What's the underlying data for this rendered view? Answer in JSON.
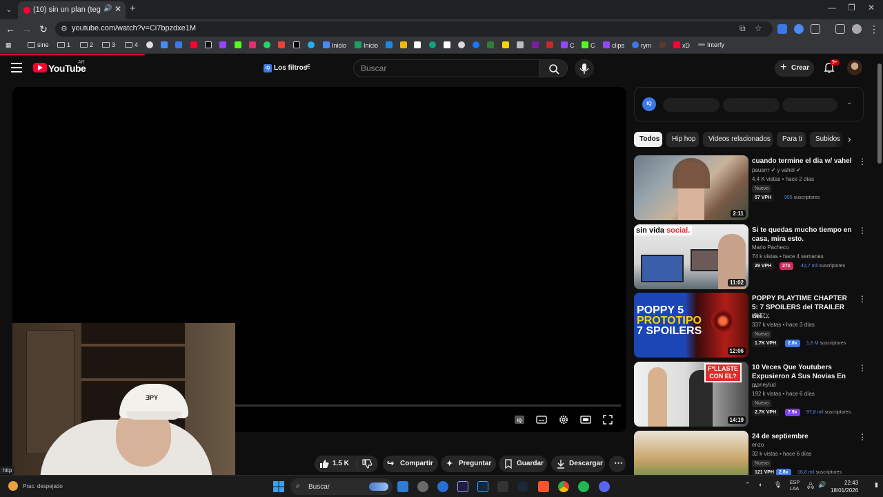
{
  "browser": {
    "tab_title": "(10) sin un plan (tegocalde...",
    "url": "youtube.com/watch?v=Ci7bpzdxe1M",
    "status_url": "http",
    "bookmarks": [
      {
        "label": "sine",
        "type": "folder"
      },
      {
        "label": "1",
        "type": "folder"
      },
      {
        "label": "2",
        "type": "folder"
      },
      {
        "label": "3",
        "type": "folder"
      },
      {
        "label": "4",
        "type": "folder"
      },
      {
        "label": "Inicio",
        "type": "link",
        "color": "#4a8af4"
      },
      {
        "label": "Inicio",
        "type": "link",
        "color": "#1aa260"
      },
      {
        "label": "C",
        "type": "link",
        "color": "#9146ff"
      },
      {
        "label": "C",
        "type": "link",
        "color": "#53fc18"
      },
      {
        "label": "clips",
        "type": "link",
        "color": "#9146ff"
      },
      {
        "label": "rym",
        "type": "link",
        "color": "#3b78e7"
      },
      {
        "label": "xD",
        "type": "link",
        "color": "#ff0033"
      },
      {
        "label": "Interfy",
        "type": "link",
        "color": "#888888"
      }
    ]
  },
  "youtube": {
    "logo_text": "YouTube",
    "country": "AR",
    "filters_label": "Los filtros",
    "search_placeholder": "Buscar",
    "create_label": "Crear",
    "notifications_badge": "9+"
  },
  "actions": {
    "likes": "1.5 K",
    "share": "Compartir",
    "ask": "Preguntar",
    "save": "Guardar",
    "download": "Descargar"
  },
  "webcam": {
    "cap_text": "ƎPY"
  },
  "iq_panel": {
    "logo": "IQ"
  },
  "chips": [
    "Todos",
    "Hip hop",
    "Videos relacionados",
    "Para ti",
    "Subidos"
  ],
  "recommendations": [
    {
      "title": "cuando termine el dia w/ vahel",
      "channel": "pausrrr ✔ y vahel ✔",
      "meta": "4.4 K vistas • hace 2 días",
      "badge": "Nuevo",
      "vph": "57 VPH",
      "multiplier": "",
      "subs_count": "955",
      "subs_label": "suscriptores",
      "duration": "2:11",
      "thumb_colors": [
        "#7d8a95",
        "#b8a58d"
      ]
    },
    {
      "title": "Si te quedas mucho tiempo en casa, mira esto.",
      "channel": "Mario Pacheco",
      "meta": "74 k vistas • hace 4 semanas",
      "badge": "",
      "vph": "29 VPH",
      "multiplier": "27x",
      "multiplier_color": "#e0245e",
      "subs_count": "40,7 mil",
      "subs_label": "suscriptores",
      "duration": "11:02",
      "thumb_text": "sin vida social.",
      "thumb_colors": [
        "#dcdcdc",
        "#5a6470"
      ]
    },
    {
      "title": "POPPY PLAYTIME CHAPTER 5: 7 SPOILERS del TRAILER del ...",
      "channel": "WIZZY",
      "meta": "337 k vistas • hace 3 días",
      "badge": "Nuevo",
      "vph": "1.7K VPH",
      "multiplier": "2.8x",
      "multiplier_color": "#3b78e7",
      "subs_count": "1,6 M",
      "subs_label": "suscriptores",
      "duration": "12:06",
      "thumb_text": "POPPY 5 PROTOTIPO 7 SPOILERS",
      "thumb_colors": [
        "#1b3fa8",
        "#c0201c"
      ]
    },
    {
      "title": "10 Veces Que Youtubers Expusieron A Sus Novias En ...",
      "channel": "moneylud",
      "meta": "192 k vistas • hace 6 días",
      "badge": "Nuevo",
      "vph": "2.7K VPH",
      "multiplier": "7.9x",
      "multiplier_color": "#7b3fe4",
      "subs_count": "97,8 mil",
      "subs_label": "suscriptores",
      "duration": "14:19",
      "thumb_text": "F*LLASTE CON EL?",
      "thumb_colors": [
        "#e8e8e8",
        "#3a3a3a"
      ]
    },
    {
      "title": "24 de septiembre",
      "channel": "enzo",
      "meta": "32 k vistas • hace 6 días",
      "badge": "Nuevo",
      "vph": "121 VPH",
      "multiplier": "2.8x",
      "multiplier_color": "#3b78e7",
      "subs_count": "16,8 mil",
      "subs_label": "suscriptores",
      "duration": "",
      "thumb_colors": [
        "#c8a060",
        "#7a8f4a"
      ]
    }
  ],
  "taskbar": {
    "weather": "Prac. despejado",
    "search_label": "Buscar",
    "lang": "ESP",
    "lang_sub": "LAA",
    "time": "22:43",
    "date": "18/01/2026"
  }
}
